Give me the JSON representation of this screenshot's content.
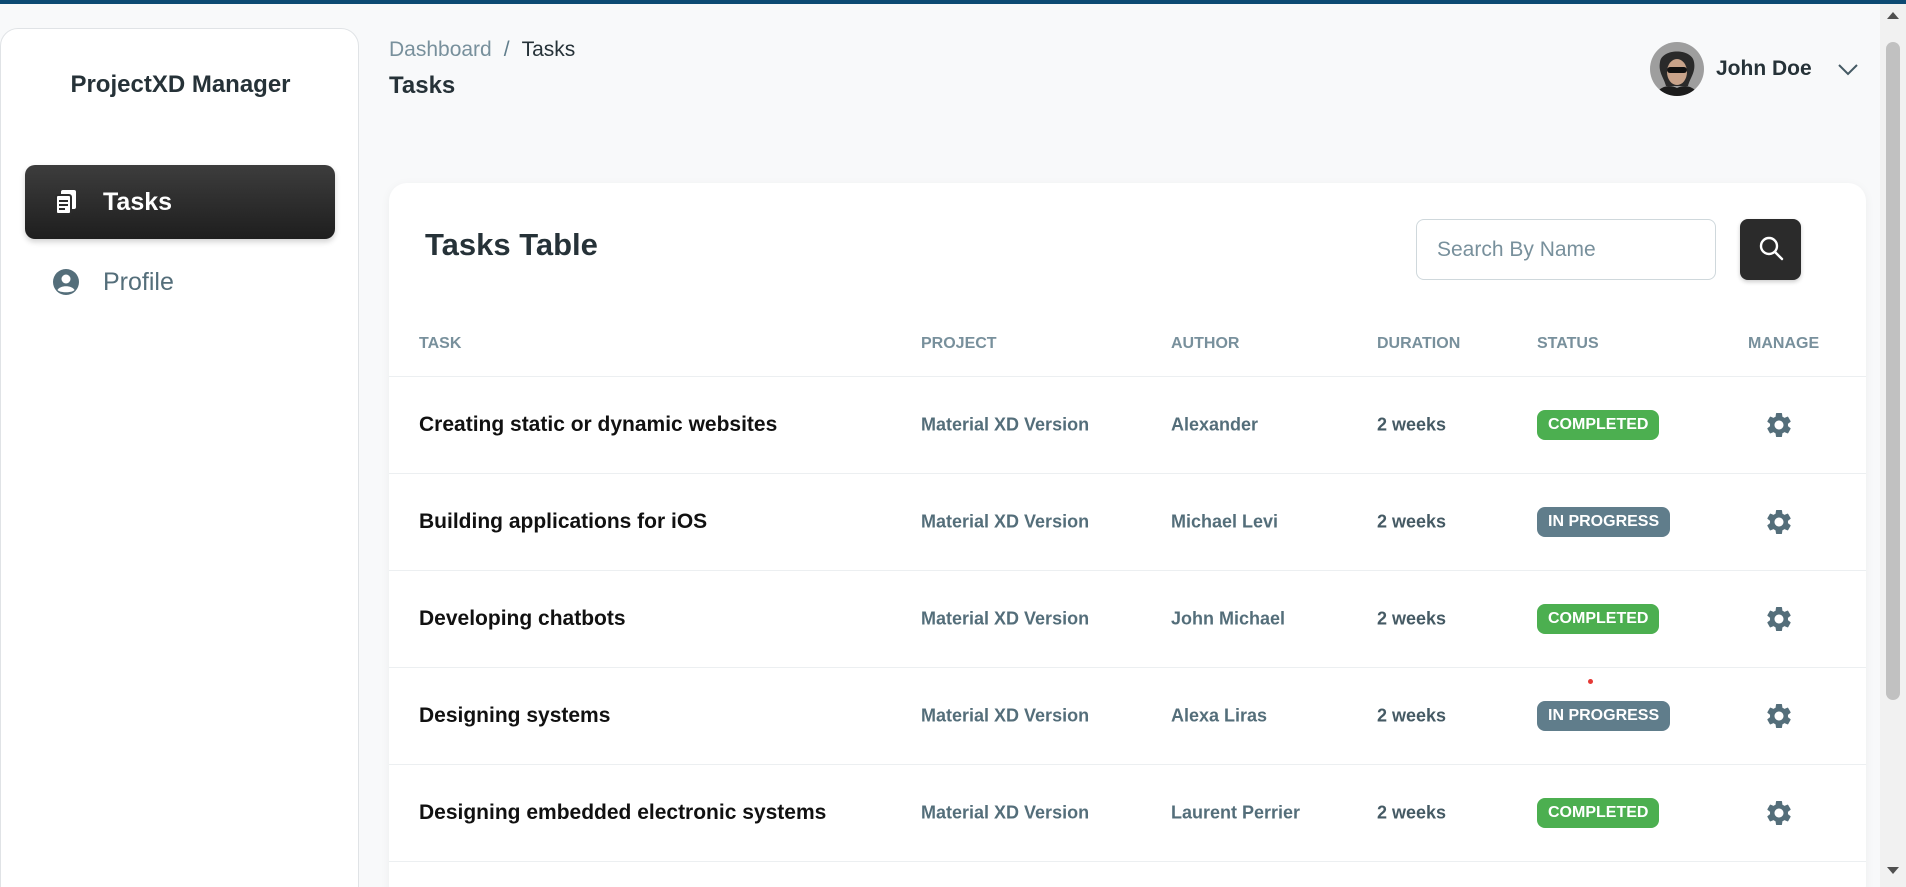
{
  "brand": {
    "title": "ProjectXD Manager"
  },
  "sidebar": {
    "items": [
      {
        "label": "Tasks",
        "icon": "copy-document-icon",
        "active": true
      },
      {
        "label": "Profile",
        "icon": "user-circle-icon",
        "active": false
      }
    ]
  },
  "header": {
    "breadcrumb": {
      "parent": "Dashboard",
      "separator": "/",
      "current": "Tasks"
    },
    "title": "Tasks",
    "user": {
      "name": "John Doe",
      "icon": "chevron-down-icon"
    }
  },
  "card": {
    "title": "Tasks Table",
    "search": {
      "placeholder": "Search By Name",
      "value": "",
      "icon": "search-icon"
    },
    "columns": [
      "TASK",
      "PROJECT",
      "AUTHOR",
      "DURATION",
      "STATUS",
      "MANAGE"
    ],
    "rows": [
      {
        "task": "Creating static or dynamic websites",
        "project": "Material XD Version",
        "author": "Alexander",
        "duration": "2 weeks",
        "status": "COMPLETED"
      },
      {
        "task": "Building applications for iOS",
        "project": "Material XD Version",
        "author": "Michael Levi",
        "duration": "2 weeks",
        "status": "IN PROGRESS"
      },
      {
        "task": "Developing chatbots",
        "project": "Material XD Version",
        "author": "John Michael",
        "duration": "2 weeks",
        "status": "COMPLETED"
      },
      {
        "task": "Designing systems",
        "project": "Material XD Version",
        "author": "Alexa Liras",
        "duration": "2 weeks",
        "status": "IN PROGRESS"
      },
      {
        "task": "Designing embedded electronic systems",
        "project": "Material XD Version",
        "author": "Laurent Perrier",
        "duration": "2 weeks",
        "status": "COMPLETED"
      }
    ]
  },
  "colors": {
    "accent_dark": "#2b2b2b",
    "status_completed": "#4caf50",
    "status_in_progress": "#607d8b",
    "top_bar": "#0d4a73"
  }
}
